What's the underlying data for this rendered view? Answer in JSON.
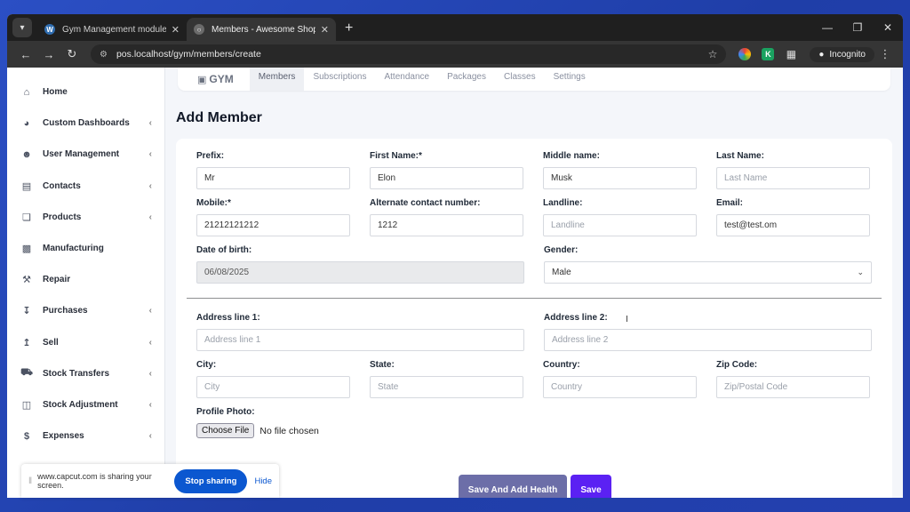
{
  "browser": {
    "tabs": [
      {
        "title": "Gym Management module for (",
        "active": false,
        "favicon": "wordpress-icon"
      },
      {
        "title": "Members - Awesome Shop",
        "active": true,
        "favicon": "globe-icon"
      }
    ],
    "url": "pos.localhost/gym/members/create",
    "incognito_label": "Incognito"
  },
  "sidebar": {
    "items": [
      {
        "label": "Home",
        "icon": "home-icon",
        "chevron": false
      },
      {
        "label": "Custom Dashboards",
        "icon": "dashboard-icon",
        "chevron": true
      },
      {
        "label": "User Management",
        "icon": "users-icon",
        "chevron": true
      },
      {
        "label": "Contacts",
        "icon": "contacts-icon",
        "chevron": true
      },
      {
        "label": "Products",
        "icon": "box-icon",
        "chevron": true
      },
      {
        "label": "Manufacturing",
        "icon": "factory-icon",
        "chevron": false
      },
      {
        "label": "Repair",
        "icon": "wrench-icon",
        "chevron": false
      },
      {
        "label": "Purchases",
        "icon": "download-icon",
        "chevron": true
      },
      {
        "label": "Sell",
        "icon": "upload-icon",
        "chevron": true
      },
      {
        "label": "Stock Transfers",
        "icon": "truck-icon",
        "chevron": true
      },
      {
        "label": "Stock Adjustment",
        "icon": "database-icon",
        "chevron": true
      },
      {
        "label": "Expenses",
        "icon": "dollar-icon",
        "chevron": true
      }
    ]
  },
  "topnav": {
    "brand": "GYM",
    "links": [
      "Members",
      "Subscriptions",
      "Attendance",
      "Packages",
      "Classes",
      "Settings"
    ],
    "active": "Members"
  },
  "page": {
    "title": "Add Member"
  },
  "form": {
    "prefix": {
      "label": "Prefix:",
      "value": "Mr"
    },
    "first_name": {
      "label": "First Name:*",
      "value": "Elon"
    },
    "middle_name": {
      "label": "Middle name:",
      "value": "Musk"
    },
    "last_name": {
      "label": "Last Name:",
      "placeholder": "Last Name"
    },
    "mobile": {
      "label": "Mobile:*",
      "value": "21212121212"
    },
    "alt_contact": {
      "label": "Alternate contact number:",
      "value": "1212"
    },
    "landline": {
      "label": "Landline:",
      "placeholder": "Landline"
    },
    "email": {
      "label": "Email:",
      "value": "test@test.om"
    },
    "dob": {
      "label": "Date of birth:",
      "value": "06/08/2025"
    },
    "gender": {
      "label": "Gender:",
      "value": "Male"
    },
    "address1": {
      "label": "Address line 1:",
      "placeholder": "Address line 1"
    },
    "address2": {
      "label": "Address line 2:",
      "placeholder": "Address line 2"
    },
    "city": {
      "label": "City:",
      "placeholder": "City"
    },
    "state": {
      "label": "State:",
      "placeholder": "State"
    },
    "country": {
      "label": "Country:",
      "placeholder": "Country"
    },
    "zip": {
      "label": "Zip Code:",
      "placeholder": "Zip/Postal Code"
    },
    "photo": {
      "label": "Profile Photo:",
      "button": "Choose File",
      "status": "No file chosen"
    }
  },
  "actions": {
    "save_health": "Save And Add Health",
    "save": "Save"
  },
  "share": {
    "message": "www.capcut.com is sharing your screen.",
    "stop": "Stop sharing",
    "hide": "Hide"
  }
}
